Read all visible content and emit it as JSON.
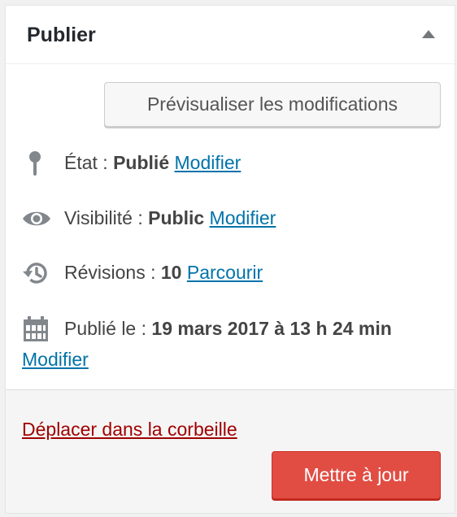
{
  "panel": {
    "title": "Publier"
  },
  "preview_button": "Prévisualiser les modifications",
  "status": {
    "label": "État :",
    "value": "Publié",
    "edit": "Modifier"
  },
  "visibility": {
    "label": "Visibilité :",
    "value": "Public",
    "edit": "Modifier"
  },
  "revisions": {
    "label": "Révisions :",
    "value": "10",
    "browse": "Parcourir"
  },
  "published": {
    "label": "Publié le :",
    "value": "19 mars 2017 à 13 h 24 min",
    "edit": "Modifier"
  },
  "trash_link": "Déplacer dans la corbeille",
  "update_button": "Mettre à jour",
  "colors": {
    "link": "#0073aa",
    "trash": "#a00000",
    "update_bg": "#e14d43",
    "icon": "#82878c"
  },
  "icons": [
    "pin-icon",
    "eye-icon",
    "history-icon",
    "calendar-icon",
    "triangle-up-icon"
  ]
}
